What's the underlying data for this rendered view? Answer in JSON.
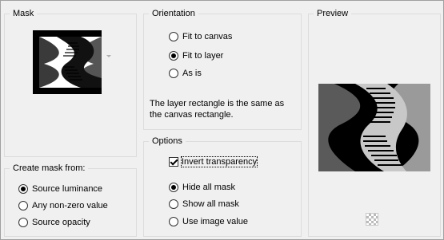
{
  "mask": {
    "title": "Mask",
    "thumbnail": "wave-pattern-thumbnail"
  },
  "create_mask": {
    "title": "Create mask from:",
    "options": [
      {
        "label": "Source luminance",
        "checked": true
      },
      {
        "label": "Any non-zero value",
        "checked": false
      },
      {
        "label": "Source opacity",
        "checked": false
      }
    ]
  },
  "orientation": {
    "title": "Orientation",
    "options": [
      {
        "label": "Fit to canvas",
        "checked": false
      },
      {
        "label": "Fit to layer",
        "checked": true
      },
      {
        "label": "As is",
        "checked": false
      }
    ],
    "info_line1": "The layer rectangle is the same as",
    "info_line2": "the canvas rectangle."
  },
  "options": {
    "title": "Options",
    "invert_label": "Invert transparency",
    "invert_checked": true,
    "radios": [
      {
        "label": "Hide all mask",
        "checked": true
      },
      {
        "label": "Show all mask",
        "checked": false
      },
      {
        "label": "Use image value",
        "checked": false
      }
    ]
  },
  "preview": {
    "title": "Preview",
    "transparency_icon": "checkerboard-icon"
  },
  "colors": {
    "background": "#f0f0f0",
    "group_border": "#dcdcdc"
  }
}
